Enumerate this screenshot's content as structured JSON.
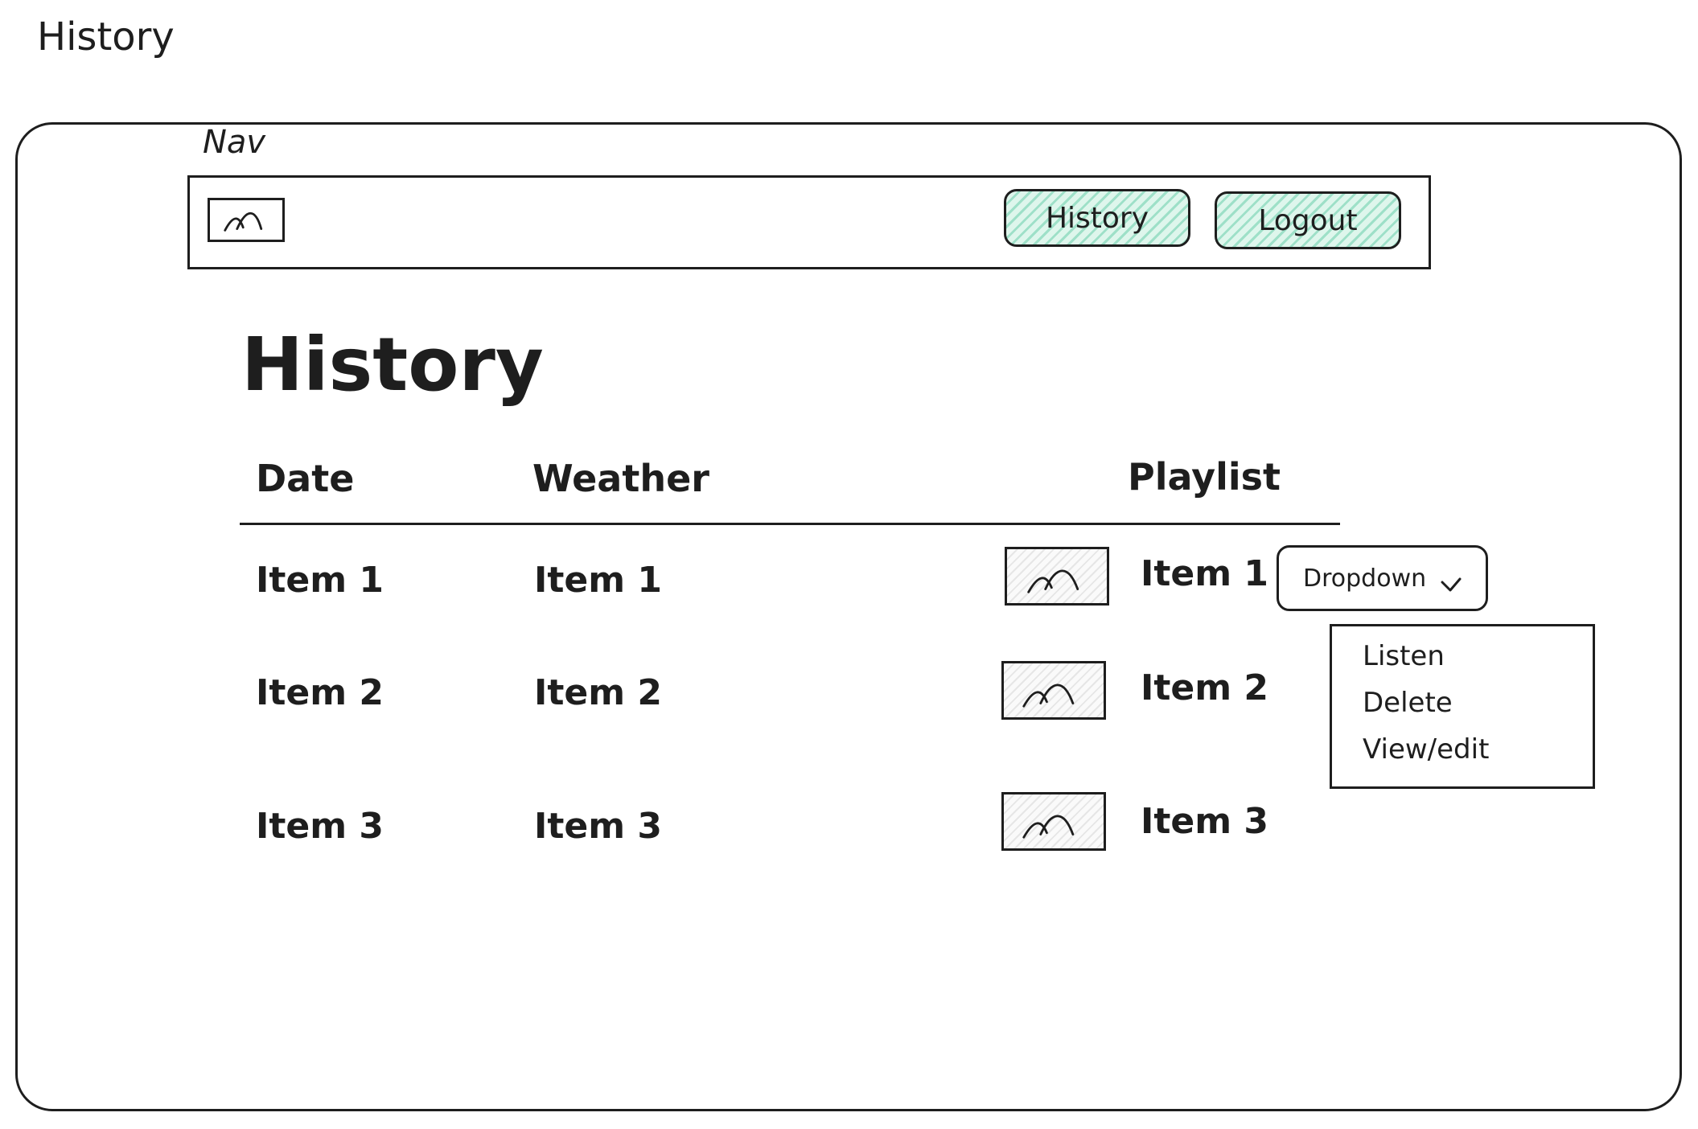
{
  "page": {
    "sketch_title": "History"
  },
  "nav": {
    "label": "Nav",
    "buttons": {
      "history": "History",
      "logout": "Logout"
    }
  },
  "main": {
    "heading": "History",
    "columns": [
      "Date",
      "Weather",
      "Playlist"
    ],
    "rows": [
      {
        "date": "Item 1",
        "weather": "Item 1",
        "playlist": "Item 1"
      },
      {
        "date": "Item 2",
        "weather": "Item 2",
        "playlist": "Item 2"
      },
      {
        "date": "Item 3",
        "weather": "Item 3",
        "playlist": "Item 3"
      }
    ],
    "dropdown": {
      "label": "Dropdown",
      "options": [
        "Listen",
        "Delete",
        "View/edit"
      ]
    }
  },
  "colors": {
    "button_fill": "#9ee0c8",
    "stroke": "#1e1e1e"
  }
}
